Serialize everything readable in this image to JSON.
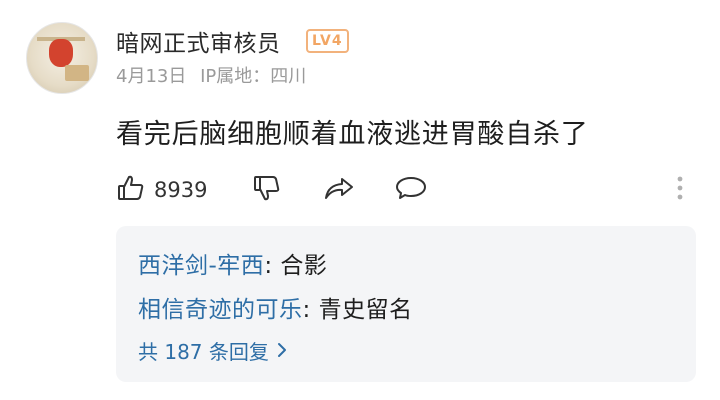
{
  "comment": {
    "username": "暗网正式审核员",
    "level_badge": "LV4",
    "date": "4月13日",
    "ip_location": "IP属地：四川",
    "text": "看完后脑细胞顺着血液逃进胃酸自杀了",
    "like_count": "8939"
  },
  "replies": [
    {
      "author": "西洋剑-牢西",
      "separator": ": ",
      "text": "合影"
    },
    {
      "author": "相信奇迹的可乐",
      "separator": ": ",
      "text": "青史留名"
    }
  ],
  "view_all_replies": "共 187 条回复",
  "icons": {
    "like": "thumbs-up-icon",
    "dislike": "thumbs-down-icon",
    "share": "share-icon",
    "comment": "comment-bubble-icon",
    "more": "more-vertical-icon",
    "chevron": "chevron-right-icon"
  },
  "colors": {
    "link_blue": "#2e6ea6",
    "badge_orange": "#f2a664",
    "reply_bg": "#f4f5f7",
    "meta_gray": "#9a9a9a"
  }
}
